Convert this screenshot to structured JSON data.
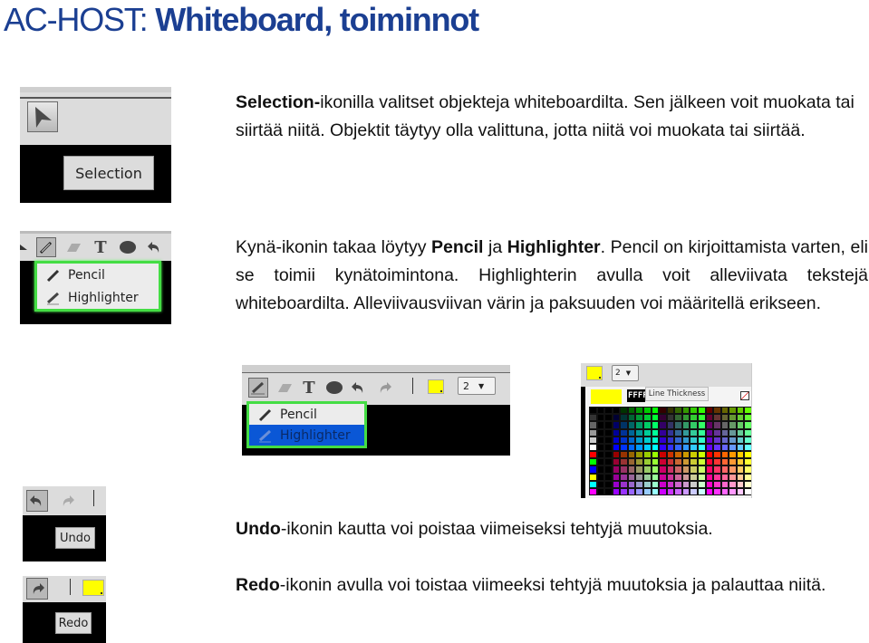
{
  "title": {
    "prefix": "AC-HOST: ",
    "main": "Whiteboard, toiminnot",
    "color": "#1b3f92"
  },
  "sections": {
    "selection": {
      "bold": "Selection-",
      "text": "ikonilla valitset objekteja whiteboardilta. Sen jälkeen voit muokata tai siirtää niitä. Objektit täytyy olla valittuna, jotta niitä voi muokata tai siirtää."
    },
    "pencil": {
      "part1": "Kynä-ikonin takaa löytyy ",
      "bold1": "Pencil",
      "part2": " ja ",
      "bold2": "Highlighter",
      "part3": ". Pencil on kirjoittamista varten, eli se toimii kynätoimintona. Highlighterin avulla voit alleviivata tekstejä whiteboardilta. Alleviivausviivan värin ja paksuuden voi määritellä erikseen."
    },
    "undo": {
      "bold": "Undo",
      "text": "-ikonin kautta voi poistaa viimeiseksi tehtyjä muutoksia."
    },
    "redo": {
      "bold": "Redo",
      "text": "-ikonin avulla voi toistaa viimeeksi tehtyjä muutoksia ja palauttaa niitä."
    }
  },
  "screenshots": {
    "selection": {
      "tooltip": "Selection",
      "icon": "arrow-cursor-icon"
    },
    "pencil_menu": {
      "tools": [
        "selection-icon",
        "pencil-icon",
        "eraser-icon",
        "text-icon",
        "shape-icon",
        "undo-icon"
      ],
      "menu_items": [
        {
          "label": "Pencil",
          "icon": "pencil-icon"
        },
        {
          "label": "Highlighter",
          "icon": "highlighter-icon"
        }
      ],
      "menu_border_color": "#44dd44"
    },
    "highlighter_menu": {
      "tools": [
        "highlighter-icon",
        "eraser-icon",
        "text-icon",
        "shape-icon",
        "undo-icon",
        "redo-icon"
      ],
      "menu_items": [
        {
          "label": "Pencil",
          "icon": "pencil-icon",
          "selected": false
        },
        {
          "label": "Highlighter",
          "icon": "highlighter-icon",
          "selected": true
        }
      ],
      "color_swatch": "#ffff00",
      "line_thickness": "2",
      "selected_color": "#0a57d6"
    },
    "palette": {
      "current_color": "#ffff00",
      "hex_value": "FFFF",
      "line_thickness": "2",
      "tooltip": "Line Thickness"
    },
    "undo": {
      "tooltip": "Undo"
    },
    "redo": {
      "tooltip": "Redo",
      "color_swatch": "#ffff00"
    }
  }
}
